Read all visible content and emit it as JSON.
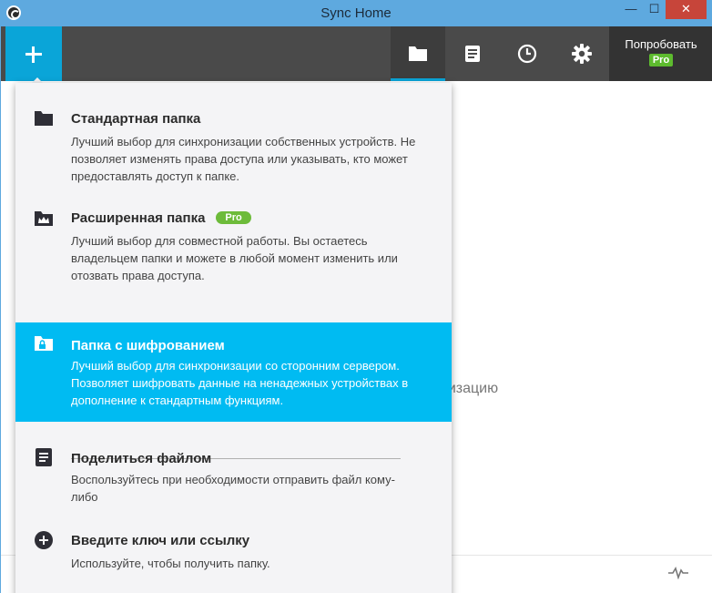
{
  "window": {
    "title": "Sync Home",
    "minimize": "—",
    "maximize": "☐",
    "close": "✕"
  },
  "toolbar": {
    "try_label": "Попробовать",
    "pro_badge": "Pro",
    "tabs": [
      "folders",
      "documents",
      "history",
      "settings"
    ]
  },
  "background": {
    "partial_text": "низацию"
  },
  "menu": {
    "items": [
      {
        "icon": "folder-icon",
        "title": "Стандартная папка",
        "desc": "Лучший выбор для синхронизации собственных устройств. Не позволяет изменять права доступа или указывать, кто может предоставлять доступ к папке."
      },
      {
        "icon": "crown-folder-icon",
        "title": "Расширенная папка",
        "pro": "Pro",
        "desc": "Лучший выбор для совместной работы. Вы остаетесь владельцем папки и можете в любой момент изменить или отозвать права доступа."
      },
      {
        "icon": "lock-folder-icon",
        "title": "Папка с шифрованием",
        "desc": "Лучший выбор для синхронизации со сторонним сервером. Позволяет шифровать данные на ненадежных устройствах в дополнение к стандартным функциям."
      },
      {
        "icon": "document-icon",
        "title": "Поделиться файлом",
        "desc": "Воспользуйтесь при необходимости отправить файл кому-либо"
      },
      {
        "icon": "plus-circle-icon",
        "title": "Введите ключ или ссылку",
        "desc": "Используйте, чтобы получить папку."
      }
    ]
  },
  "colors": {
    "accent": "#00bbf2",
    "toolbar": "#4a4a4a",
    "pro_green": "#6dbb3a",
    "title_bar": "#5ea9df",
    "close": "#c7453a"
  }
}
